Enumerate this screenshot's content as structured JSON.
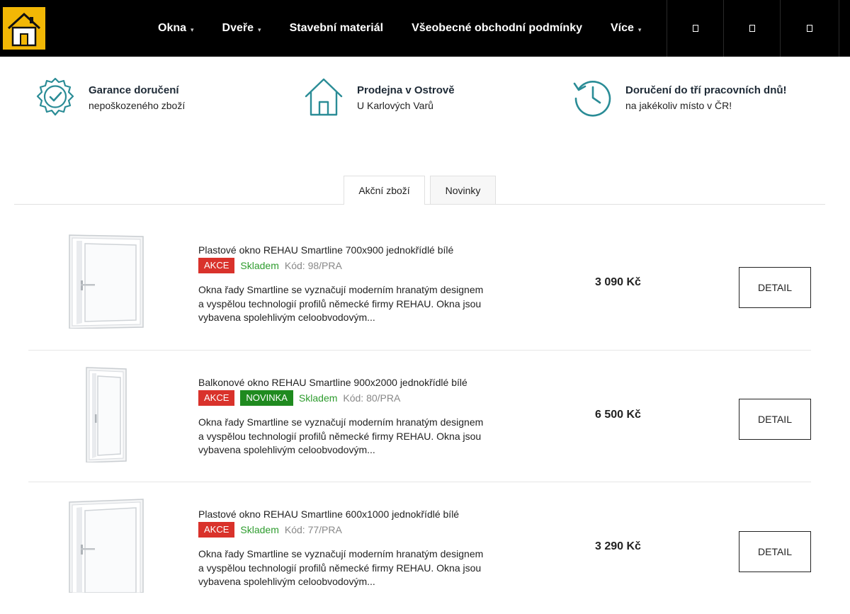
{
  "header": {
    "logo_label": "Home logo",
    "nav": [
      {
        "label": "Okna",
        "has_caret": true
      },
      {
        "label": "Dveře",
        "has_caret": true
      },
      {
        "label": "Stavební materiál",
        "has_caret": false
      },
      {
        "label": "Všeobecné obchodní podmínky",
        "has_caret": false
      },
      {
        "label": "Více",
        "has_caret": true
      }
    ],
    "icons": [
      "search-icon",
      "user-icon",
      "cart-icon"
    ],
    "background": "#000000",
    "logo_color": "#f2b705"
  },
  "benefits": [
    {
      "icon": "badge-check-icon",
      "title": "Garance doručení",
      "subtitle": "nepoškozeného zboží"
    },
    {
      "icon": "house-icon",
      "title": "Prodejna v Ostrově",
      "subtitle": "U Karlových Varů"
    },
    {
      "icon": "history-icon",
      "title": "Doručení do tří pracovních dnů!",
      "subtitle": "na jakékoliv místo v ČR!"
    }
  ],
  "tabs": [
    {
      "label": "Akční zboží",
      "active": true
    },
    {
      "label": "Novinky",
      "active": false
    }
  ],
  "products": [
    {
      "title": "Plastové okno REHAU Smartline 700x900 jednokřídlé bílé",
      "badges": [
        "AKCE"
      ],
      "stock": "Skladem",
      "code": "Kód: 98/PRA",
      "description": "Okna řady Smartline se vyznačují moderním hranatým designem a vyspělou technologií profilů německé firmy REHAU. Okna jsou vybavena spolehlivým celoobvodovým...",
      "price": "3 090 Kč",
      "button": "DETAIL"
    },
    {
      "title": "Balkonové okno REHAU Smartline 900x2000 jednokřídlé bílé",
      "badges": [
        "AKCE",
        "NOVINKA"
      ],
      "stock": "Skladem",
      "code": "Kód: 80/PRA",
      "description": "Okna řady Smartline se vyznačují moderním hranatým designem a vyspělou technologií profilů německé firmy REHAU. Okna jsou vybavena spolehlivým celoobvodovým...",
      "price": "6 500 Kč",
      "button": "DETAIL"
    },
    {
      "title": "Plastové okno REHAU Smartline 600x1000 jednokřídlé bílé",
      "badges": [
        "AKCE"
      ],
      "stock": "Skladem",
      "code": "Kód: 77/PRA",
      "description": "Okna řady Smartline se vyznačují moderním hranatým designem a vyspělou technologií profilů německé firmy REHAU. Okna jsou vybavena spolehlivým celoobvodovým...",
      "price": "3 290 Kč",
      "button": "DETAIL"
    }
  ],
  "colors": {
    "sale": "#d9322b",
    "new": "#1f8a1f",
    "stock": "#2e9c2e",
    "icon_teal": "#2a8c96"
  }
}
